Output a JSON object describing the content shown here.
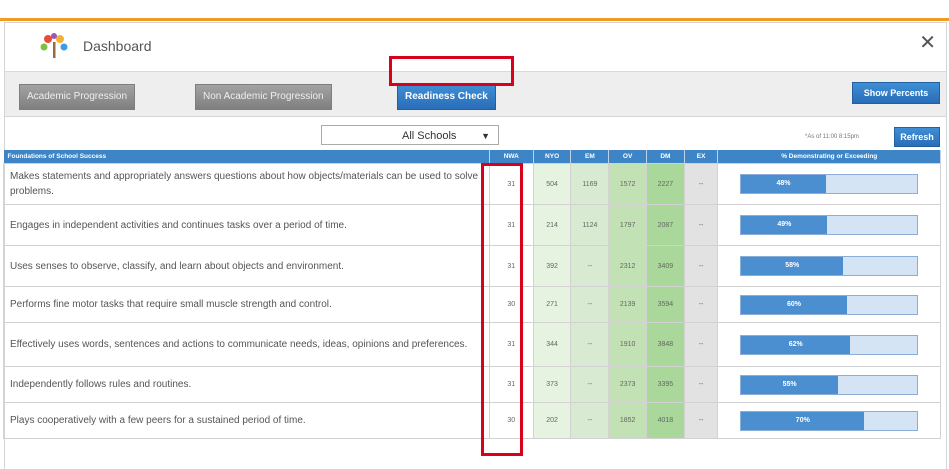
{
  "window": {
    "title": "Dashboard"
  },
  "tabs": [
    {
      "label": "Academic Progression",
      "active": false
    },
    {
      "label": "Non Academic Progression",
      "active": false
    },
    {
      "label": "Readiness Check",
      "active": true
    }
  ],
  "toolbar": {
    "show_percents_label": "Show Percents"
  },
  "filter": {
    "school_select_value": "All Schools",
    "as_of_text": "*As of 11:00 8:15pm",
    "refresh_label": "Refresh"
  },
  "table": {
    "headers": [
      "Foundations of School Success",
      "NWA",
      "NYO",
      "EM",
      "OV",
      "DM",
      "EX",
      "% Demonstrating or Exceeding"
    ],
    "rows": [
      {
        "desc": "Makes statements and appropriately answers questions about how objects/materials can be used to solve problems.",
        "nwa": "31",
        "nyo": "504",
        "em": "1169",
        "ov": "1572",
        "dm": "2227",
        "ex": "--",
        "pct_label": "48%",
        "pct": 48
      },
      {
        "desc": "Engages in independent activities and continues tasks over a period of time.",
        "nwa": "31",
        "nyo": "214",
        "em": "1124",
        "ov": "1797",
        "dm": "2087",
        "ex": "--",
        "pct_label": "49%",
        "pct": 49
      },
      {
        "desc": "Uses senses to observe, classify, and learn about objects and environment.",
        "nwa": "31",
        "nyo": "392",
        "em": "--",
        "ov": "2312",
        "dm": "3409",
        "ex": "--",
        "pct_label": "58%",
        "pct": 58
      },
      {
        "desc": "Performs fine motor tasks that require small muscle strength and control.",
        "nwa": "30",
        "nyo": "271",
        "em": "--",
        "ov": "2139",
        "dm": "3594",
        "ex": "--",
        "pct_label": "60%",
        "pct": 60
      },
      {
        "desc": "Effectively uses words, sentences and actions to communicate needs, ideas, opinions and preferences.",
        "nwa": "31",
        "nyo": "344",
        "em": "--",
        "ov": "1910",
        "dm": "3848",
        "ex": "--",
        "pct_label": "62%",
        "pct": 62
      },
      {
        "desc": "Independently follows rules and routines.",
        "nwa": "31",
        "nyo": "373",
        "em": "--",
        "ov": "2373",
        "dm": "3395",
        "ex": "--",
        "pct_label": "55%",
        "pct": 55
      },
      {
        "desc": "Plays cooperatively with a few peers for a sustained period of time.",
        "nwa": "30",
        "nyo": "202",
        "em": "--",
        "ov": "1852",
        "dm": "4018",
        "ex": "--",
        "pct_label": "70%",
        "pct": 70
      }
    ]
  },
  "colors": {
    "accent": "#f39a24",
    "header_blue": "#3d85c6",
    "highlight": "#d9001b"
  }
}
